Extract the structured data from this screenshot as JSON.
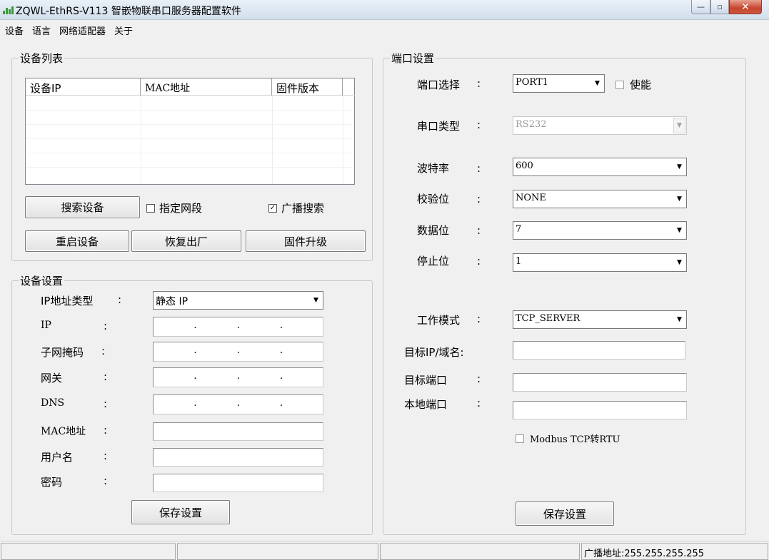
{
  "window": {
    "title": "ZQWL-EthRS-V113  智嵌物联串口服务器配置软件",
    "min_glyph": "—",
    "max_glyph": "▫",
    "close_glyph": "✕"
  },
  "menu": {
    "items": [
      "设备",
      "语言",
      "网络适配器",
      "关于"
    ]
  },
  "device_list_group": {
    "title": "设备列表",
    "columns": [
      "设备IP",
      "MAC地址",
      "固件版本"
    ],
    "rows": [],
    "search_button": "搜索设备",
    "specify_segment": {
      "label": "指定网段",
      "checked": false
    },
    "broadcast_search": {
      "label": "广播搜索",
      "checked": true
    },
    "restart_button": "重启设备",
    "factory_reset_button": "恢复出厂",
    "firmware_upgrade_button": "固件升级"
  },
  "device_settings": {
    "title": "设备设置",
    "ip_type_label": "IP地址类型",
    "ip_type_value": "静态 IP",
    "ip_label": "IP",
    "subnet_label": "子网掩码",
    "gateway_label": "网关",
    "dns_label": "DNS",
    "mac_label": "MAC地址",
    "username_label": "用户名",
    "password_label": "密码",
    "colon": ":",
    "dot": ".",
    "save_button": "保存设置"
  },
  "port_settings": {
    "title": "端口设置",
    "colon": ":",
    "port_select_label": "端口选择",
    "port_select_value": "PORT1",
    "enable_label": "使能",
    "enable_checked": false,
    "serial_type_label": "串口类型",
    "serial_type_value": "RS232",
    "baud_label": "波特率",
    "baud_value": "600",
    "parity_label": "校验位",
    "parity_value": "NONE",
    "data_bits_label": "数据位",
    "data_bits_value": "7",
    "stop_bits_label": "停止位",
    "stop_bits_value": "1",
    "work_mode_label": "工作模式",
    "work_mode_value": "TCP_SERVER",
    "target_ip_label": "目标IP/域名:",
    "target_port_label": "目标端口",
    "local_port_label": "本地端口",
    "modbus_label": "Modbus TCP转RTU",
    "modbus_checked": false,
    "save_button": "保存设置"
  },
  "statusbar": {
    "broadcast_address": "广播地址:255.255.255.255"
  }
}
